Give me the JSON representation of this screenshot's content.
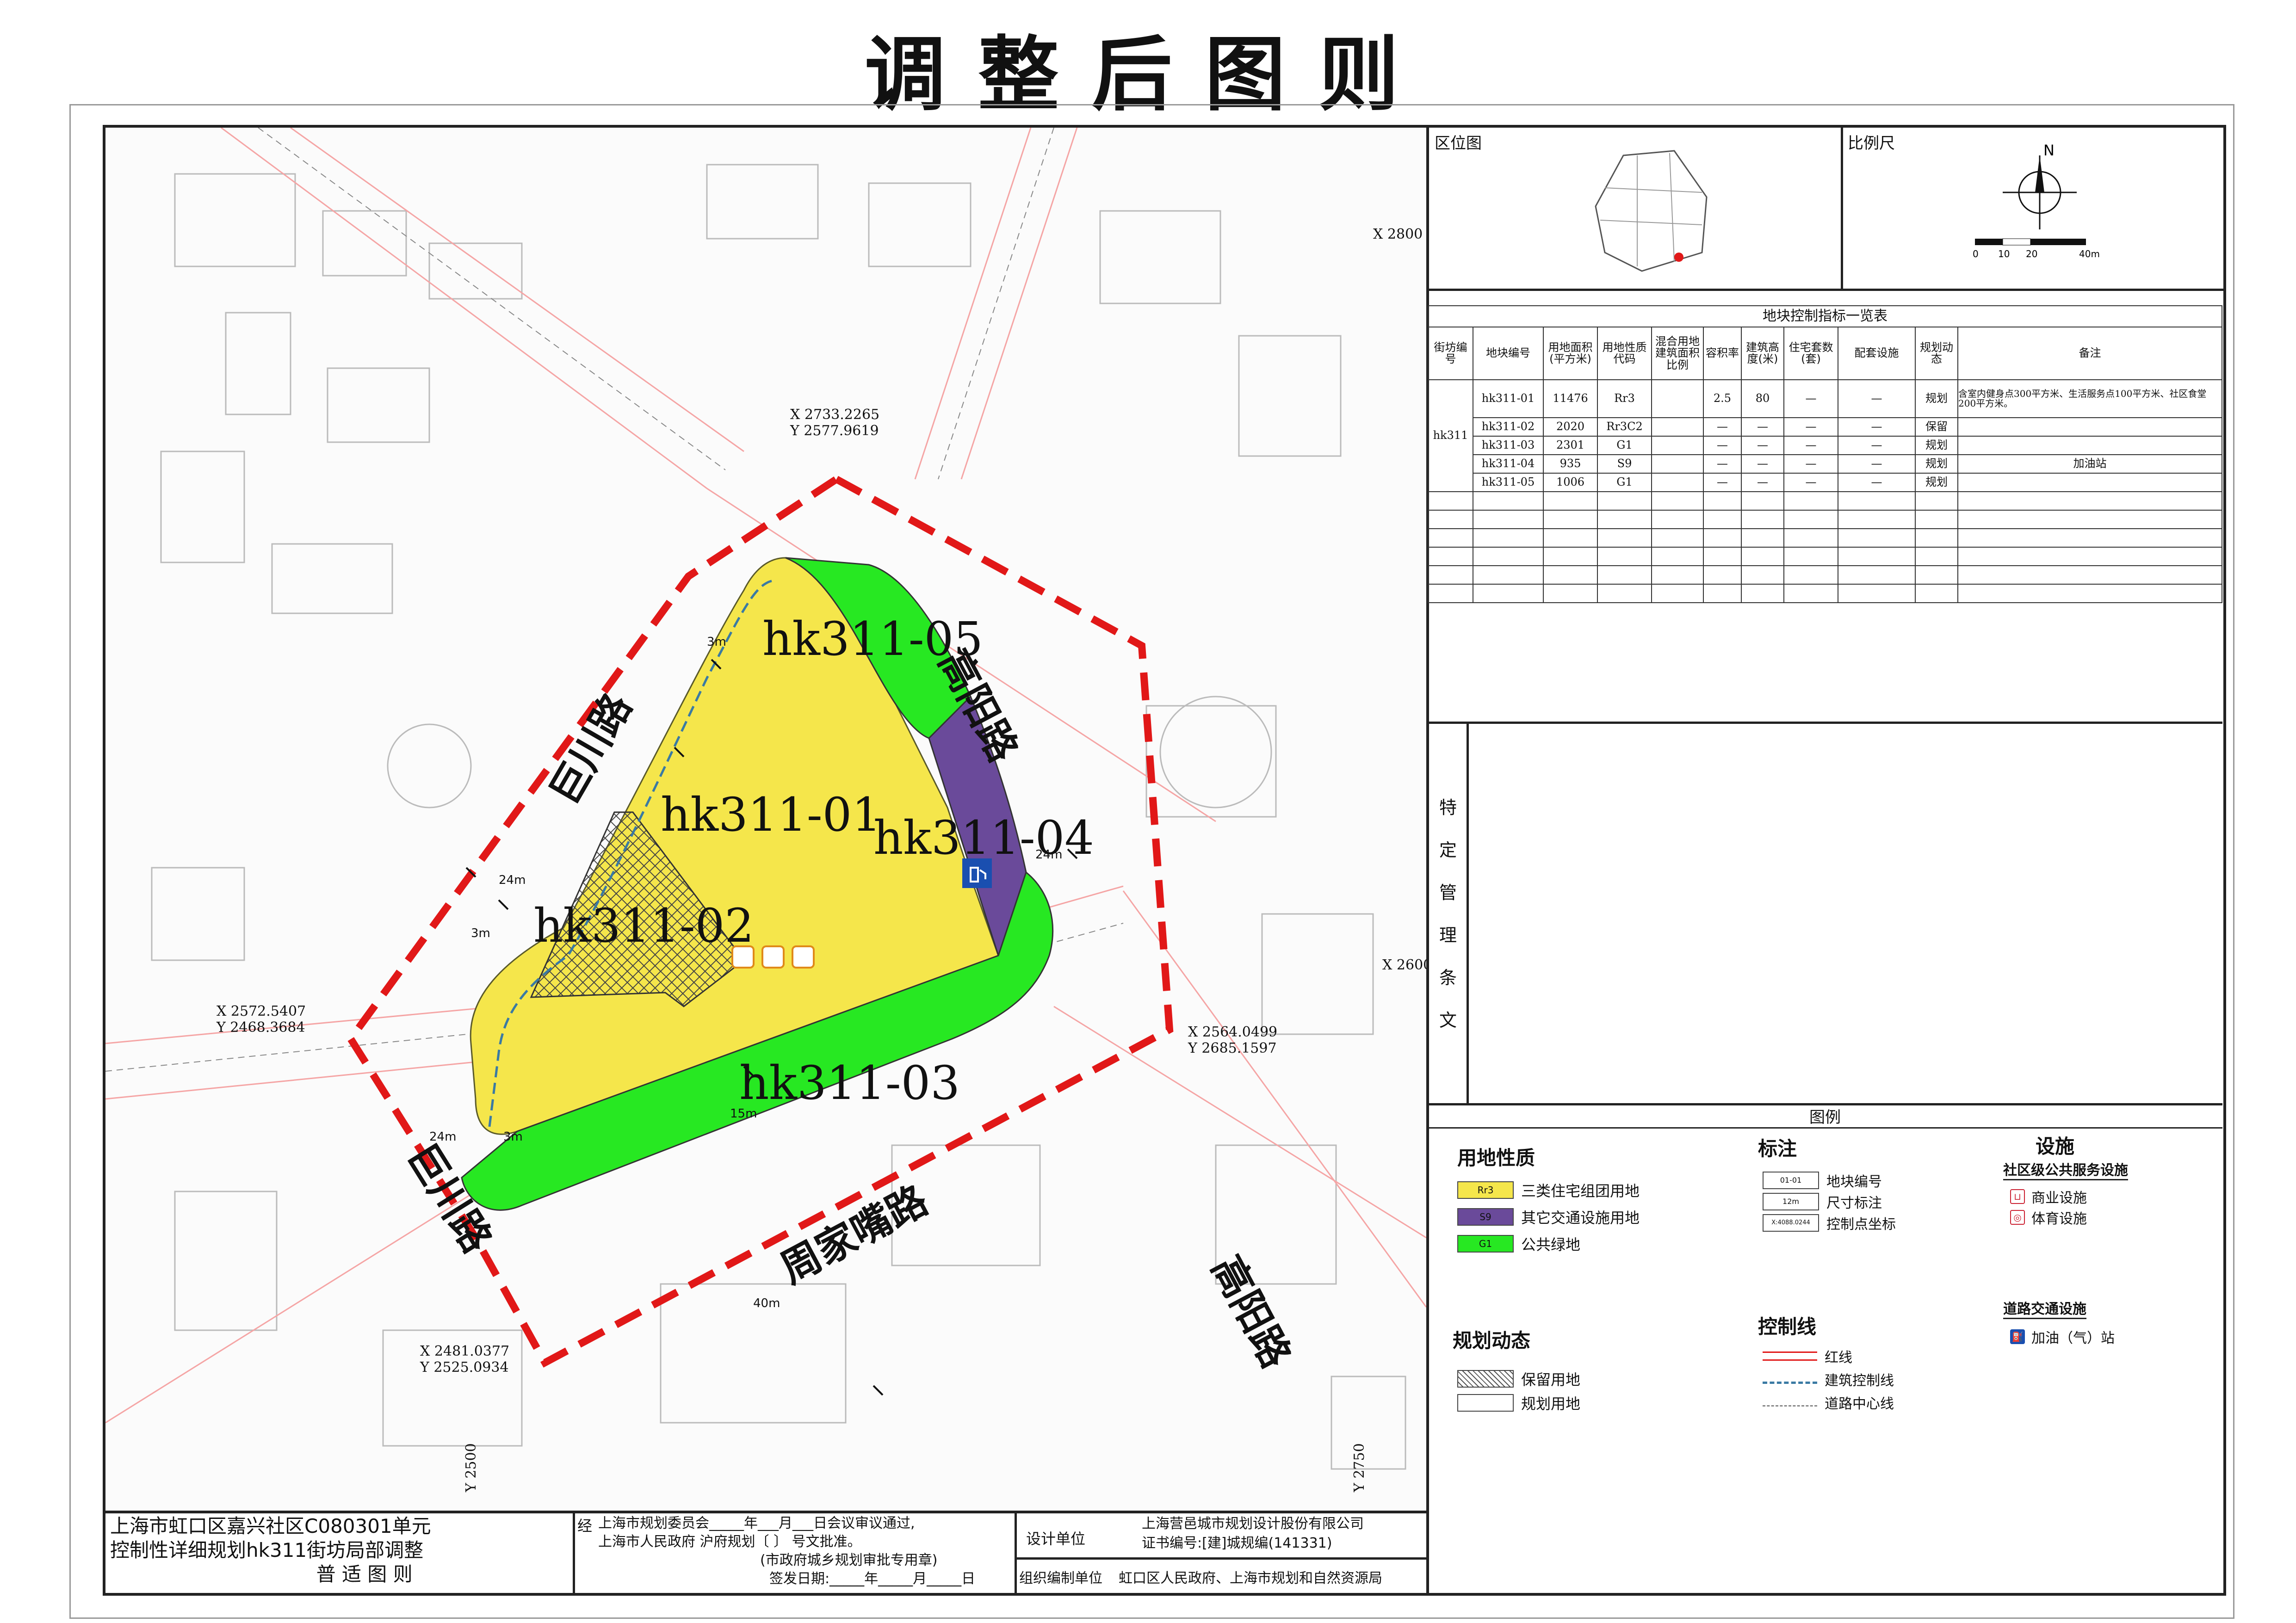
{
  "title": "调整后图则",
  "map": {
    "parcels": [
      "hk311-05",
      "hk311-01",
      "hk311-04",
      "hk311-02",
      "hk311-03"
    ],
    "roads": [
      "巨川路",
      "高阳路",
      "周家嘴路",
      "高阳路",
      "巨川路"
    ],
    "coords": [
      {
        "x": "X 2733.2265",
        "y": "Y 2577.9619"
      },
      {
        "x": "X 2572.5407",
        "y": "Y 2468.3684"
      },
      {
        "x": "X 2564.0499",
        "y": "Y 2685.1597"
      },
      {
        "x": "X 2481.0377",
        "y": "Y 2525.0934"
      }
    ],
    "grid": [
      "X 2800",
      "X 2600",
      "Y 2500",
      "Y 2750"
    ],
    "dims": [
      "24m",
      "24m",
      "3m",
      "3m",
      "3m",
      "15m",
      "40m",
      "24m"
    ],
    "colors": {
      "residential": "#f5e64b",
      "transport": "#6a4a9a",
      "green": "#27e822",
      "boundary": "#e11818"
    }
  },
  "side": {
    "location_label": "区位图",
    "scale_label": "比例尺",
    "north": "N",
    "scale_ticks": [
      "0",
      "10",
      "20",
      "40m"
    ],
    "table": {
      "caption": "地块控制指标一览表",
      "headers": [
        "街坊编号",
        "地块编号",
        "用地面积(平方米)",
        "用地性质代码",
        "混合用地建筑面积比例",
        "容积率",
        "建筑高度(米)",
        "住宅套数(套)",
        "配套设施",
        "规划动态",
        "备注"
      ],
      "block": "hk311",
      "rows": [
        [
          "hk311-01",
          "11476",
          "Rr3",
          "",
          "2.5",
          "80",
          "—",
          "—",
          "规划",
          "含室内健身点300平方米、生活服务点100平方米、社区食堂200平方米。"
        ],
        [
          "hk311-02",
          "2020",
          "Rr3C2",
          "",
          "—",
          "—",
          "—",
          "—",
          "保留",
          ""
        ],
        [
          "hk311-03",
          "2301",
          "G1",
          "",
          "—",
          "—",
          "—",
          "—",
          "规划",
          ""
        ],
        [
          "hk311-04",
          "935",
          "S9",
          "",
          "—",
          "—",
          "—",
          "—",
          "规划",
          "加油站"
        ],
        [
          "hk311-05",
          "1006",
          "G1",
          "",
          "—",
          "—",
          "—",
          "—",
          "规划",
          ""
        ]
      ]
    },
    "special_label": "特定管理条文",
    "legend": {
      "title": "图例",
      "land_use_title": "用地性质",
      "land_use": [
        {
          "code": "Rr3",
          "label": "三类住宅组团用地",
          "color": "#f5e64b"
        },
        {
          "code": "S9",
          "label": "其它交通设施用地",
          "color": "#6a4a9a"
        },
        {
          "code": "G1",
          "label": "公共绿地",
          "color": "#27e822"
        }
      ],
      "marks_title": "标注",
      "marks": [
        {
          "sample": "01-01",
          "label": "地块编号"
        },
        {
          "sample": "12m",
          "label": "尺寸标注"
        },
        {
          "sample": "X:4088.0244",
          "label": "控制点坐标"
        }
      ],
      "facility_title": "设施",
      "facility_sub": "社区级公共服务设施",
      "facilities": [
        "商业设施",
        "体育设施"
      ],
      "dynamic_title": "规划动态",
      "dynamic": [
        "保留用地",
        "规划用地"
      ],
      "control_title": "控制线",
      "control": [
        "红线",
        "建筑控制线",
        "道路中心线"
      ],
      "traffic_title": "道路交通设施",
      "traffic": [
        "加油（气）站"
      ]
    }
  },
  "bottom": {
    "project_line1": "上海市虹口区嘉兴社区C080301单元",
    "project_line2": "控制性详细规划hk311街坊局部调整",
    "project_line3": "普 适 图 则",
    "approval_prefix": "经",
    "approval1": "上海市规划委员会_____年___月___日会议审议通过,",
    "approval2": "上海市人民政府       沪府规划〔      〕      号文批准。",
    "approval3": "(市政府城乡规划审批专用章)",
    "approval4": "签发日期:_____年_____月_____日",
    "design_label": "设计单位",
    "design_company": "上海营邑城市规划设计股份有限公司",
    "design_cert": "证书编号:[建]城规编(141331)",
    "org_label": "组织编制单位",
    "org_name": "虹口区人民政府、上海市规划和自然资源局"
  }
}
